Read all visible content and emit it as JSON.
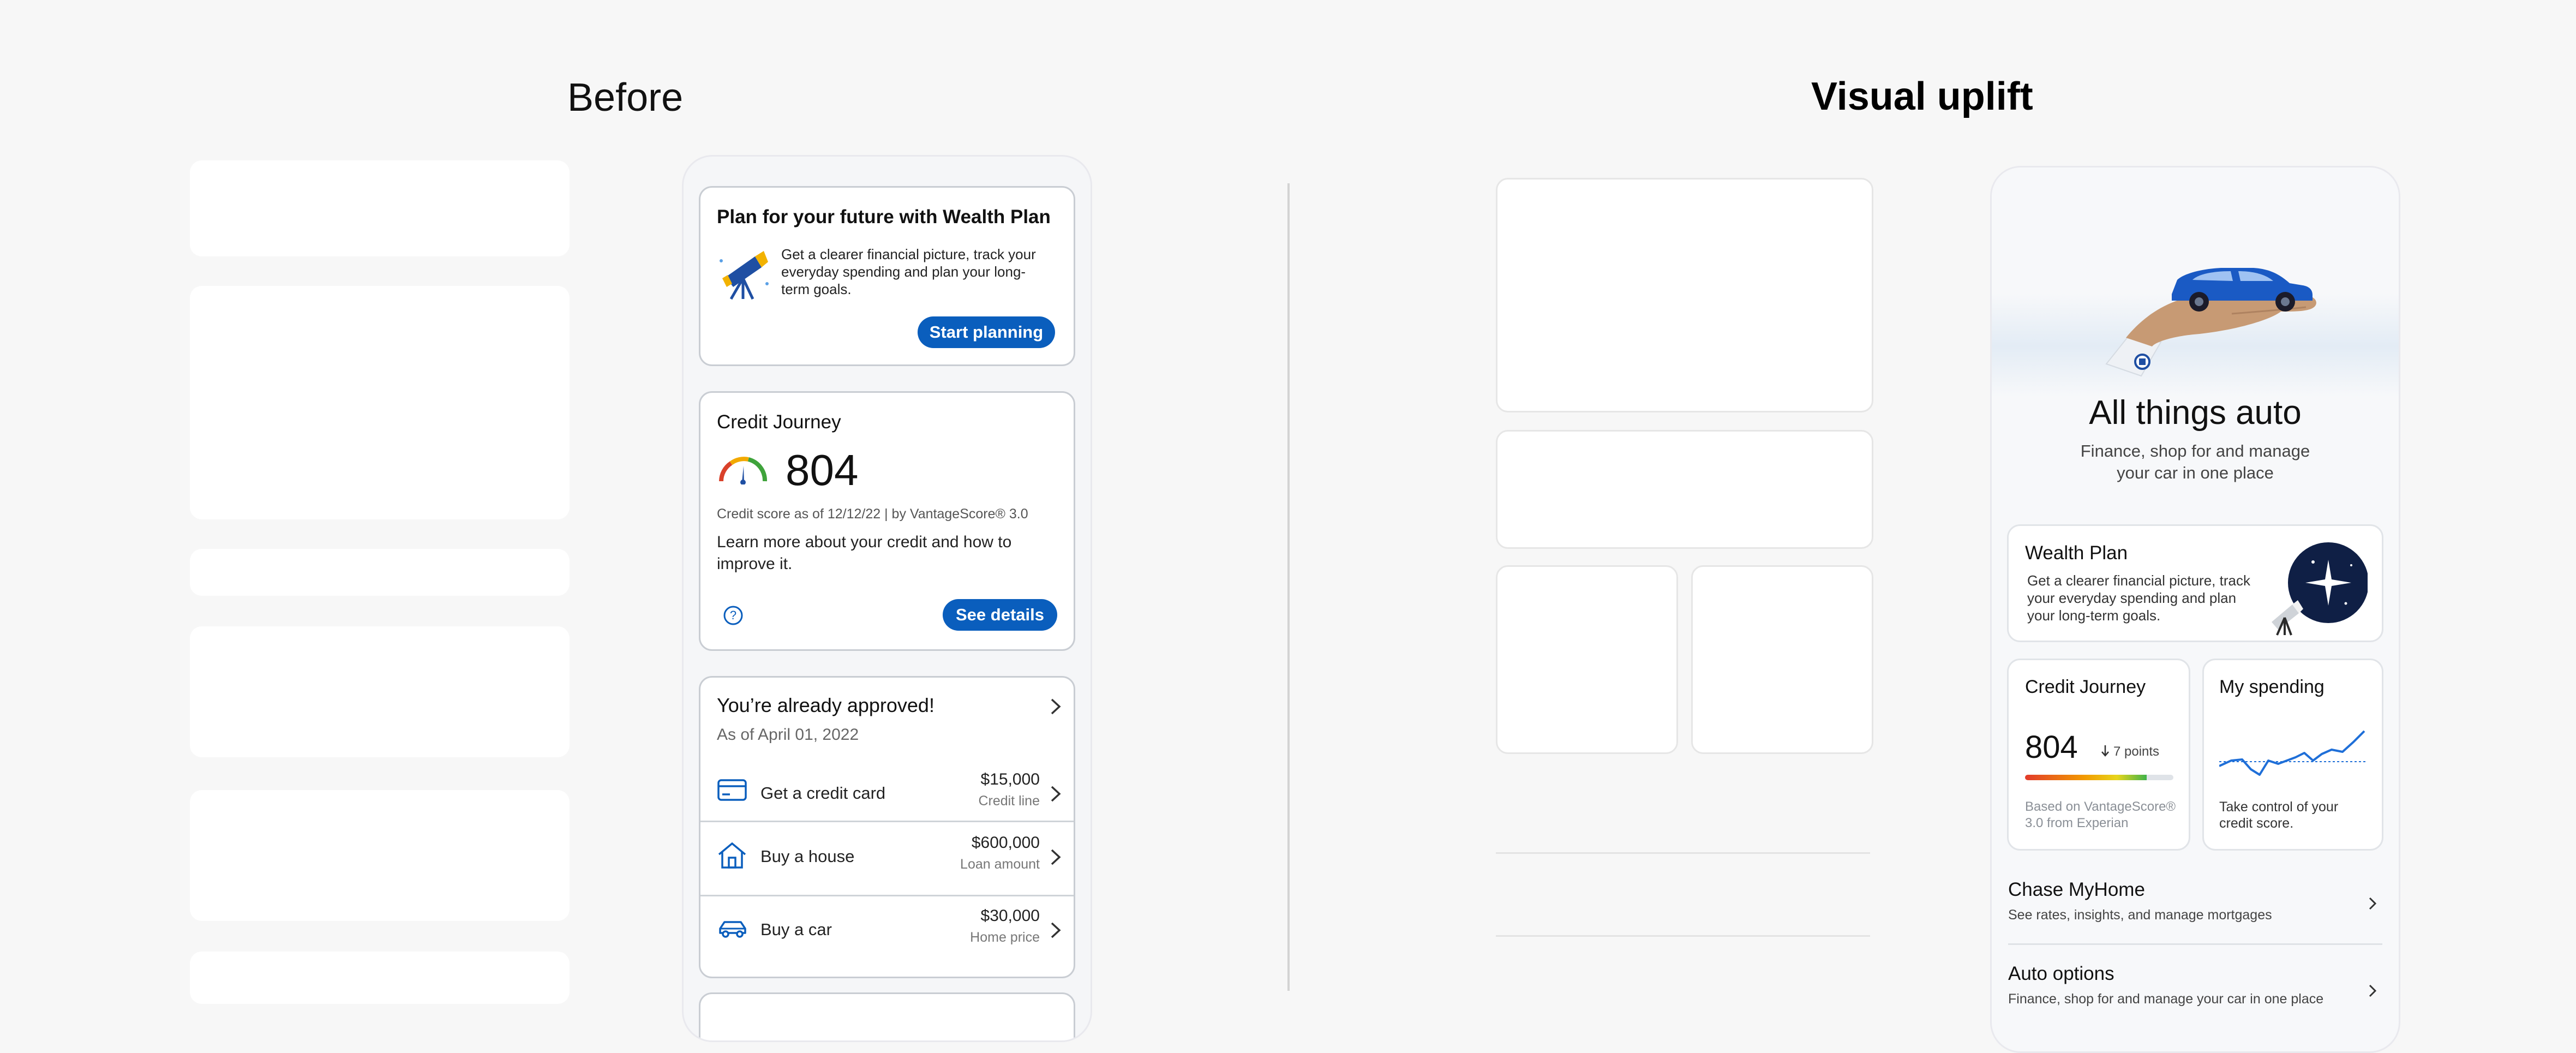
{
  "headings": {
    "before": "Before",
    "uplift": "Visual uplift"
  },
  "before_phone": {
    "wealth_card": {
      "title": "Plan for your future with Wealth Plan",
      "body": "Get a clearer financial picture, track your everyday spending and plan your long-term goals.",
      "button": "Start planning"
    },
    "credit_card": {
      "title": "Credit Journey",
      "score": "804",
      "meta": "Credit score as of 12/12/22 | by VantageScore® 3.0",
      "body": "Learn more about your credit and how to improve it.",
      "button": "See details"
    },
    "approved_card": {
      "title": "You’re already approved!",
      "subtitle": "As of April 01, 2022",
      "rows": [
        {
          "label": "Get a credit card",
          "amount": "$15,000",
          "sub": "Credit line",
          "icon": "credit-card-icon"
        },
        {
          "label": "Buy a house",
          "amount": "$600,000",
          "sub": "Loan amount",
          "icon": "house-icon"
        },
        {
          "label": "Buy a car",
          "amount": "$30,000",
          "sub": "Home price",
          "icon": "car-icon"
        }
      ]
    }
  },
  "uplift_phone": {
    "hero": {
      "title": "All things auto",
      "subtitle": "Finance, shop for and manage your car in one place"
    },
    "wealth_card": {
      "title": "Wealth Plan",
      "body": "Get a clearer financial picture, track your everyday spending and plan your long-term goals."
    },
    "credit_card": {
      "title": "Credit Journey",
      "score": "804",
      "change": "7 points",
      "footnote": "Based on VantageScore® 3.0 from Experian"
    },
    "spending_card": {
      "title": "My spending",
      "body": "Take control of your credit score."
    },
    "list": [
      {
        "title": "Chase MyHome",
        "subtitle": "See rates, insights, and  manage mortgages"
      },
      {
        "title": "Auto options",
        "subtitle": "Finance, shop for and manage your car in one place"
      }
    ]
  },
  "colors": {
    "brand_blue": "#0a5ebd",
    "background": "#f7f7f7",
    "card_border": "#c9cdd3"
  }
}
